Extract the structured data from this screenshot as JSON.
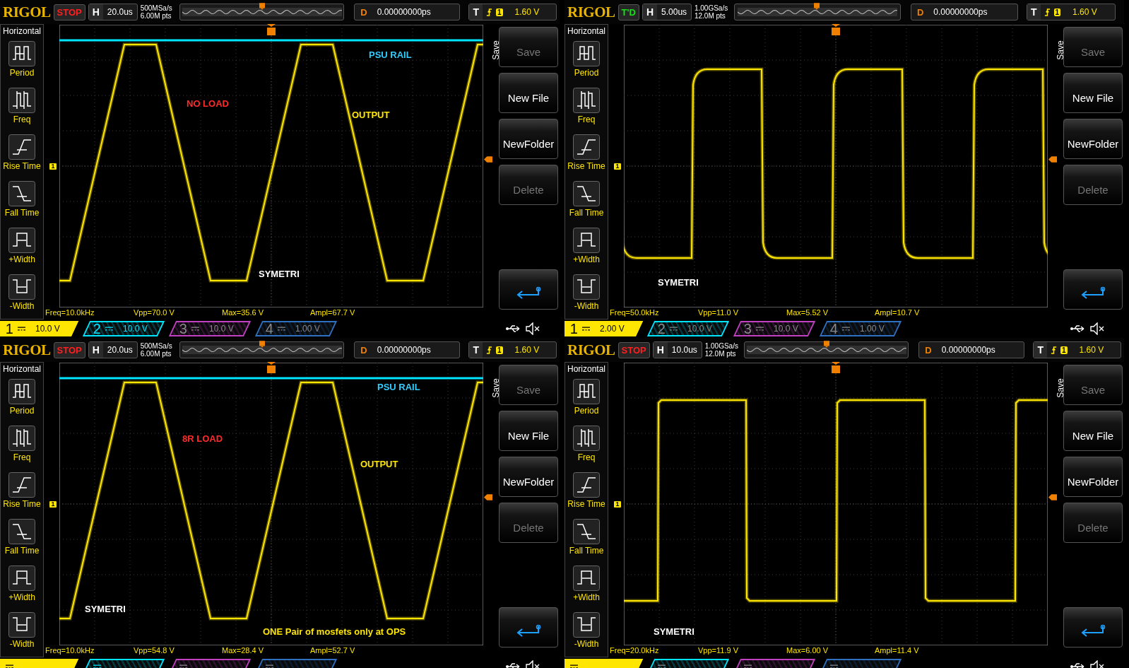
{
  "panels": [
    {
      "top_bar": {
        "logo": "RIGOL",
        "run_state": {
          "label": "STOP",
          "kind": "stop"
        },
        "h_label": "H",
        "timebase": "20.0us",
        "sample_rate": "500MSa/s",
        "memory_depth": "6.00M pts",
        "d_label": "D",
        "delay": "0.00000000ps",
        "t_label": "T",
        "trigger_source": "1",
        "trigger_level": "1.60 V"
      },
      "menu": {
        "title": "Horizontal",
        "items": [
          {
            "label": "Period",
            "kind": "period"
          },
          {
            "label": "Freq",
            "kind": "freq"
          },
          {
            "label": "Rise Time",
            "kind": "rise"
          },
          {
            "label": "Fall Time",
            "kind": "fall"
          },
          {
            "label": "+Width",
            "kind": "pwidth"
          },
          {
            "label": "-Width",
            "kind": "nwidth"
          }
        ]
      },
      "waveform": {
        "kind": "trapezoid",
        "rail": true,
        "marker": "1"
      },
      "annotations": [
        {
          "text": "PSU RAIL",
          "color": "#33ccff"
        },
        {
          "text": "NO LOAD",
          "color": "#ff2a2a"
        },
        {
          "text": "OUTPUT",
          "color": "#ffe600"
        },
        {
          "text": "SYMETRI",
          "color": "#ffffff"
        }
      ],
      "softkeys": {
        "title": "Save",
        "keys": [
          {
            "kind": "text",
            "label": "Save",
            "disabled": true
          },
          {
            "kind": "text",
            "label": "New File",
            "disabled": false
          },
          {
            "kind": "text",
            "label": "NewFolder",
            "disabled": false
          },
          {
            "kind": "text",
            "label": "Delete",
            "disabled": true
          },
          {
            "kind": "enter"
          }
        ]
      },
      "measurements": [
        "Freq=10.0kHz",
        "Vpp=70.0 V",
        "Max=35.6 V",
        "Ampl=67.7 V"
      ],
      "channels": [
        {
          "number": "1",
          "scale": "10.0 V",
          "on": true,
          "selected": true,
          "color": "#ffe600"
        },
        {
          "number": "2",
          "scale": "10.0 V",
          "on": true,
          "selected": false,
          "color": "#00e5ff"
        },
        {
          "number": "3",
          "scale": "10.0 V",
          "on": false,
          "selected": false,
          "color": "#c040c0"
        },
        {
          "number": "4",
          "scale": "1.00 V",
          "on": false,
          "selected": false,
          "color": "#3070c0"
        }
      ]
    },
    {
      "top_bar": {
        "logo": "RIGOL",
        "run_state": {
          "label": "T'D",
          "kind": "triggered"
        },
        "h_label": "H",
        "timebase": "5.00us",
        "sample_rate": "1.00GSa/s",
        "memory_depth": "12.0M pts",
        "d_label": "D",
        "delay": "0.00000000ps",
        "t_label": "T",
        "trigger_source": "1",
        "trigger_level": "1.60 V"
      },
      "menu": {
        "title": "Horizontal",
        "items": [
          {
            "label": "Period",
            "kind": "period"
          },
          {
            "label": "Freq",
            "kind": "freq"
          },
          {
            "label": "Rise Time",
            "kind": "rise"
          },
          {
            "label": "Fall Time",
            "kind": "fall"
          },
          {
            "label": "+Width",
            "kind": "pwidth"
          },
          {
            "label": "-Width",
            "kind": "nwidth"
          }
        ]
      },
      "waveform": {
        "kind": "square-soft",
        "marker": "1"
      },
      "annotations": [
        {
          "text": "SYMETRI",
          "color": "#ffffff"
        }
      ],
      "softkeys": {
        "title": "Save",
        "keys": [
          {
            "kind": "text",
            "label": "Save",
            "disabled": true
          },
          {
            "kind": "text",
            "label": "New File",
            "disabled": false
          },
          {
            "kind": "text",
            "label": "NewFolder",
            "disabled": false
          },
          {
            "kind": "text",
            "label": "Delete",
            "disabled": true
          },
          {
            "kind": "enter"
          }
        ]
      },
      "measurements": [
        "Freq=50.0kHz",
        "Vpp=11.0 V",
        "Max=5.52 V",
        "Ampl=10.7 V"
      ],
      "channels": [
        {
          "number": "1",
          "scale": "2.00 V",
          "on": true,
          "selected": true,
          "color": "#ffe600"
        },
        {
          "number": "2",
          "scale": "10.0 V",
          "on": false,
          "selected": false,
          "color": "#00e5ff"
        },
        {
          "number": "3",
          "scale": "10.0 V",
          "on": false,
          "selected": false,
          "color": "#c040c0"
        },
        {
          "number": "4",
          "scale": "1.00 V",
          "on": false,
          "selected": false,
          "color": "#3070c0"
        }
      ]
    },
    {
      "top_bar": {
        "logo": "RIGOL",
        "run_state": {
          "label": "STOP",
          "kind": "stop"
        },
        "h_label": "H",
        "timebase": "20.0us",
        "sample_rate": "500MSa/s",
        "memory_depth": "6.00M pts",
        "d_label": "D",
        "delay": "0.00000000ps",
        "t_label": "T",
        "trigger_source": "1",
        "trigger_level": "1.60 V"
      },
      "menu": {
        "title": "Horizontal",
        "items": [
          {
            "label": "Period",
            "kind": "period"
          },
          {
            "label": "Freq",
            "kind": "freq"
          },
          {
            "label": "Rise Time",
            "kind": "rise"
          },
          {
            "label": "Fall Time",
            "kind": "fall"
          },
          {
            "label": "+Width",
            "kind": "pwidth"
          },
          {
            "label": "-Width",
            "kind": "nwidth"
          }
        ]
      },
      "waveform": {
        "kind": "trapezoid",
        "rail": true,
        "marker": "1"
      },
      "annotations": [
        {
          "text": "PSU RAIL",
          "color": "#33ccff"
        },
        {
          "text": "8R LOAD",
          "color": "#ff2a2a"
        },
        {
          "text": "OUTPUT",
          "color": "#ffe600"
        },
        {
          "text": "SYMETRI",
          "color": "#ffffff"
        },
        {
          "text": "ONE Pair of mosfets only at OPS",
          "color": "#ffe600"
        }
      ],
      "softkeys": {
        "title": "Save",
        "keys": [
          {
            "kind": "text",
            "label": "Save",
            "disabled": true
          },
          {
            "kind": "text",
            "label": "New File",
            "disabled": false
          },
          {
            "kind": "text",
            "label": "NewFolder",
            "disabled": false
          },
          {
            "kind": "text",
            "label": "Delete",
            "disabled": true
          },
          {
            "kind": "enter"
          }
        ]
      },
      "measurements": [
        "Freq=10.0kHz",
        "Vpp=54.8 V",
        "Max=28.4 V",
        "Ampl=52.7 V"
      ],
      "channels": [
        {
          "on": true,
          "selected": true,
          "color": "#ffe600"
        },
        {
          "on": true,
          "selected": false,
          "color": "#00e5ff"
        },
        {
          "on": false,
          "selected": false,
          "color": "#c040c0"
        },
        {
          "on": false,
          "selected": false,
          "color": "#3070c0"
        }
      ]
    },
    {
      "top_bar": {
        "logo": "RIGOL",
        "run_state": {
          "label": "STOP",
          "kind": "stop"
        },
        "h_label": "H",
        "timebase": "10.0us",
        "sample_rate": "1.00GSa/s",
        "memory_depth": "12.0M pts",
        "d_label": "D",
        "delay": "0.00000000ps",
        "t_label": "T",
        "trigger_source": "1",
        "trigger_level": "1.60 V"
      },
      "menu": {
        "title": "Horizontal",
        "items": [
          {
            "label": "Period",
            "kind": "period"
          },
          {
            "label": "Freq",
            "kind": "freq"
          },
          {
            "label": "Rise Time",
            "kind": "rise"
          },
          {
            "label": "Fall Time",
            "kind": "fall"
          },
          {
            "label": "+Width",
            "kind": "pwidth"
          },
          {
            "label": "-Width",
            "kind": "nwidth"
          }
        ]
      },
      "waveform": {
        "kind": "square-sharp",
        "marker": "1"
      },
      "annotations": [
        {
          "text": "SYMETRI",
          "color": "#ffffff"
        }
      ],
      "softkeys": {
        "title": "Save",
        "keys": [
          {
            "kind": "text",
            "label": "Save",
            "disabled": true
          },
          {
            "kind": "text",
            "label": "New File",
            "disabled": false
          },
          {
            "kind": "text",
            "label": "NewFolder",
            "disabled": false
          },
          {
            "kind": "text",
            "label": "Delete",
            "disabled": true
          },
          {
            "kind": "enter"
          }
        ]
      },
      "measurements": [
        "Freq=20.0kHz",
        "Vpp=11.9 V",
        "Max=6.00 V",
        "Ampl=11.4 V"
      ],
      "channels": [
        {
          "on": true,
          "selected": true,
          "color": "#ffe600"
        },
        {
          "on": false,
          "selected": false,
          "color": "#00e5ff"
        },
        {
          "on": false,
          "selected": false,
          "color": "#c040c0"
        },
        {
          "on": false,
          "selected": false,
          "color": "#3070c0"
        }
      ]
    }
  ]
}
